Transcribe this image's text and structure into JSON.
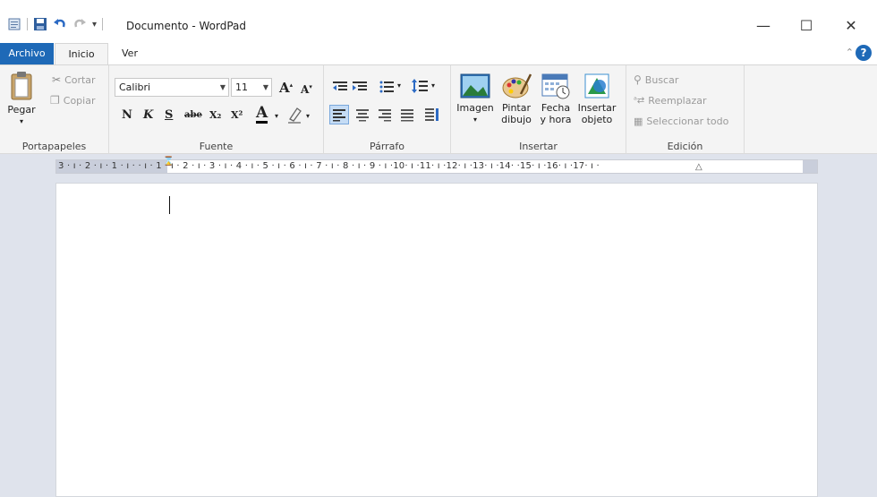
{
  "window": {
    "title": "Documento - WordPad",
    "minimize": "—",
    "maximize": "☐",
    "close": "✕"
  },
  "tabs": {
    "file": "Archivo",
    "home": "Inicio",
    "view": "Ver"
  },
  "ribbon": {
    "clipboard": {
      "label": "Portapapeles",
      "paste": "Pegar",
      "cut": "Cortar",
      "copy": "Copiar"
    },
    "font": {
      "label": "Fuente",
      "family": "Calibri",
      "size": "11",
      "bold": "N",
      "italic": "K",
      "underline": "S",
      "strike": "abe",
      "subscript": "X₂",
      "superscript": "X²",
      "grow": "A",
      "shrink": "A",
      "color": "A"
    },
    "paragraph": {
      "label": "Párrafo"
    },
    "insert": {
      "label": "Insertar",
      "image": "Imagen",
      "paint_line1": "Pintar",
      "paint_line2": "dibujo",
      "datetime_line1": "Fecha",
      "datetime_line2": "y hora",
      "object_line1": "Insertar",
      "object_line2": "objeto"
    },
    "editing": {
      "label": "Edición",
      "find": "Buscar",
      "replace": "Reemplazar",
      "select_all": "Seleccionar todo"
    }
  },
  "ruler": {
    "text": "3 · ı · 2 · ı · 1 · ı ·   · ı · 1 · ı · 2 · ı · 3 · ı · 4 · ı · 5 · ı · 6 · ı · 7 · ı · 8 · ı · 9 · ı ·10· ı ·11· ı ·12· ı ·13· ı ·14·   ·15· ı ·16· ı ·17· ı ·"
  },
  "colors": {
    "accent": "#1e69b7",
    "ribbon_bg": "#f4f4f4",
    "workspace_bg": "#dfe3ec"
  }
}
